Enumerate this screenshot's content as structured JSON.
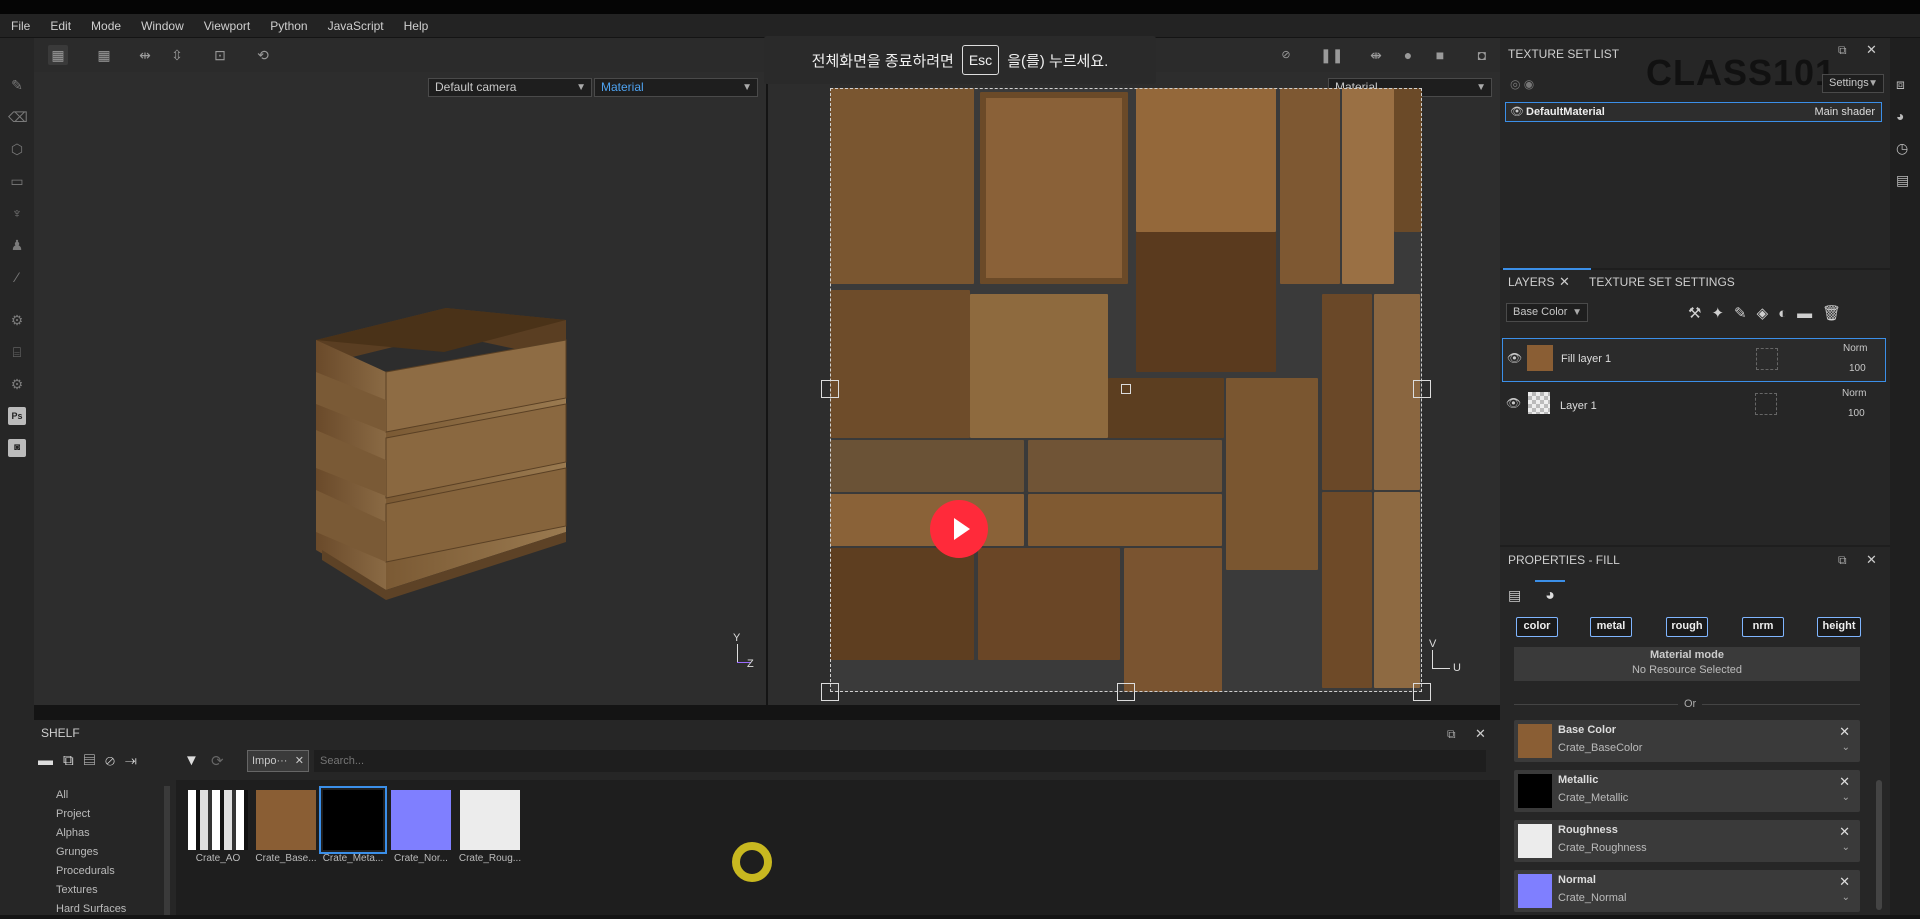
{
  "menu": [
    "File",
    "Edit",
    "Mode",
    "Window",
    "Viewport",
    "Python",
    "JavaScript",
    "Help"
  ],
  "viewport3d": {
    "camera_select": "Default camera",
    "channel_select": "Material",
    "axis_y": "Y",
    "axis_z": "Z"
  },
  "viewport2d": {
    "channel_select": "Material",
    "axis_v": "V",
    "axis_u": "U"
  },
  "fullscreen_notice": {
    "before": "전체화면을 종료하려면",
    "key": "Esc",
    "after": "을(를) 누르세요."
  },
  "watermark": "CLASS101",
  "texture_set_list": {
    "title": "TEXTURE SET LIST",
    "settings_label": "Settings",
    "item_name": "DefaultMaterial",
    "item_shader": "Main shader"
  },
  "layers": {
    "tab_layers": "LAYERS",
    "tab_texture_settings": "TEXTURE SET SETTINGS",
    "channel": "Base Color",
    "items": [
      {
        "name": "Fill layer 1",
        "blend": "Norm",
        "opacity": "100"
      },
      {
        "name": "Layer 1",
        "blend": "Norm",
        "opacity": "100"
      }
    ]
  },
  "properties": {
    "title": "PROPERTIES - FILL",
    "chips": [
      "color",
      "metal",
      "rough",
      "nrm",
      "height"
    ],
    "material_mode": "Material mode",
    "no_resource": "No Resource Selected",
    "or": "Or",
    "slots": [
      {
        "label": "Base Color",
        "value": "Crate_BaseColor",
        "color": "#8a5e34"
      },
      {
        "label": "Metallic",
        "value": "Crate_Metallic",
        "color": "#000000"
      },
      {
        "label": "Roughness",
        "value": "Crate_Roughness",
        "color": "#ececec"
      },
      {
        "label": "Normal",
        "value": "Crate_Normal",
        "color": "#7f7fff"
      }
    ]
  },
  "shelf": {
    "title": "SHELF",
    "filter_tag": "Impo···",
    "search_placeholder": "Search...",
    "categories": [
      "All",
      "Project",
      "Alphas",
      "Grunges",
      "Procedurals",
      "Textures",
      "Hard Surfaces"
    ],
    "thumbs": [
      {
        "label": "Crate_AO"
      },
      {
        "label": "Crate_Base..."
      },
      {
        "label": "Crate_Meta..."
      },
      {
        "label": "Crate_Nor..."
      },
      {
        "label": "Crate_Roug..."
      }
    ]
  },
  "colors": {
    "accent": "#3b8fe8",
    "play": "#ff2a3a",
    "cursor_ring": "#c8b820"
  }
}
